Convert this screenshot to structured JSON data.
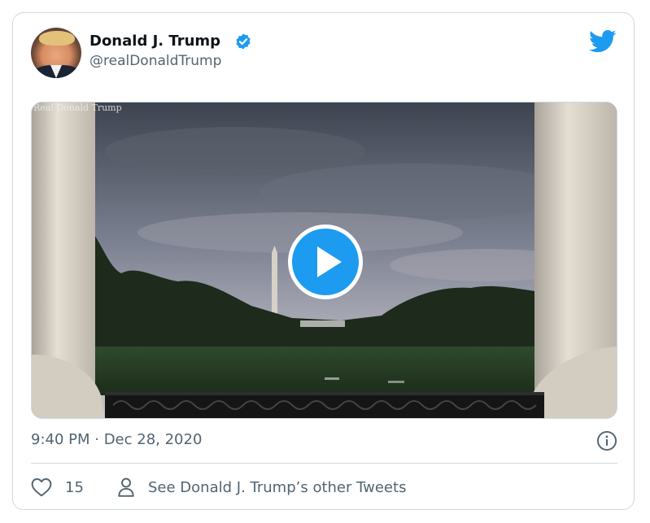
{
  "tweet": {
    "author_name": "Donald J. Trump",
    "author_handle": "@realDonaldTrump",
    "verified": true,
    "timestamp": "9:40 PM · Dec 28, 2020",
    "media": {
      "type": "video",
      "watermark": "Real Donald Trump"
    },
    "likes": "15",
    "other_tweets_label": "See Donald J. Trump’s other Tweets"
  },
  "icons": {
    "logo": "twitter-bird-icon",
    "verified": "verified-badge-icon",
    "play": "play-icon",
    "info": "info-icon",
    "like": "heart-icon",
    "profile": "person-icon"
  },
  "colors": {
    "accent": "#1d9bf0",
    "text_primary": "#0f1419",
    "text_secondary": "#536471",
    "border": "#cfd9de"
  }
}
